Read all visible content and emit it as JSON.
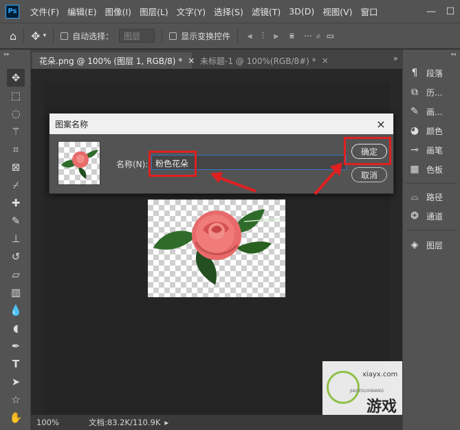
{
  "app": {
    "logo": "Ps"
  },
  "menu": [
    "文件(F)",
    "编辑(E)",
    "图像(I)",
    "图层(L)",
    "文字(Y)",
    "选择(S)",
    "滤镜(T)",
    "3D(D)",
    "视图(V)",
    "窗口"
  ],
  "window_controls": {
    "minimize": "—",
    "maximize": "☐"
  },
  "options": {
    "auto_select_label": "自动选择：",
    "layer_select_value": "图层",
    "show_transform_label": "显示变换控件"
  },
  "tabs": [
    {
      "label": "花朵.png @ 100% (图层 1, RGB/8) *",
      "close": "×"
    },
    {
      "label": "未标题-1 @ 100%(RGB/8#) *",
      "close": "×"
    }
  ],
  "tab_overflow": "»",
  "panel_collapse": "◂◂",
  "panels": [
    {
      "label": "段落",
      "icon": "paragraph-icon",
      "glyph": "¶"
    },
    {
      "label": "历...",
      "icon": "history-icon",
      "glyph": "⧉"
    },
    {
      "label": "画...",
      "icon": "brush-settings-icon",
      "glyph": "✎"
    },
    {
      "label": "颜色",
      "icon": "color-palette-icon",
      "glyph": "◕"
    },
    {
      "label": "画笔",
      "icon": "brushes-icon",
      "glyph": "⊸"
    },
    {
      "label": "色板",
      "icon": "swatches-icon",
      "glyph": "▦"
    },
    {
      "label": "路径",
      "icon": "paths-icon",
      "glyph": "⌓"
    },
    {
      "label": "通道",
      "icon": "channels-icon",
      "glyph": "❂"
    },
    {
      "label": "图层",
      "icon": "layers-icon",
      "glyph": "◈"
    }
  ],
  "dialog": {
    "title": "图案名称",
    "close": "×",
    "name_label": "名称(N):",
    "name_value": "粉色花朵",
    "ok_label": "确定",
    "cancel_label": "取消"
  },
  "status": {
    "zoom": "100%",
    "doc": "文档:83.2K/110.9K",
    "arrow": "▸"
  },
  "watermark": {
    "text": "xiayx.com",
    "sub": "JIAOYOUXIWANG",
    "big": "游戏"
  },
  "colors": {
    "accent_red": "#e02020",
    "ui_gray": "#535353",
    "canvas": "#282828"
  }
}
